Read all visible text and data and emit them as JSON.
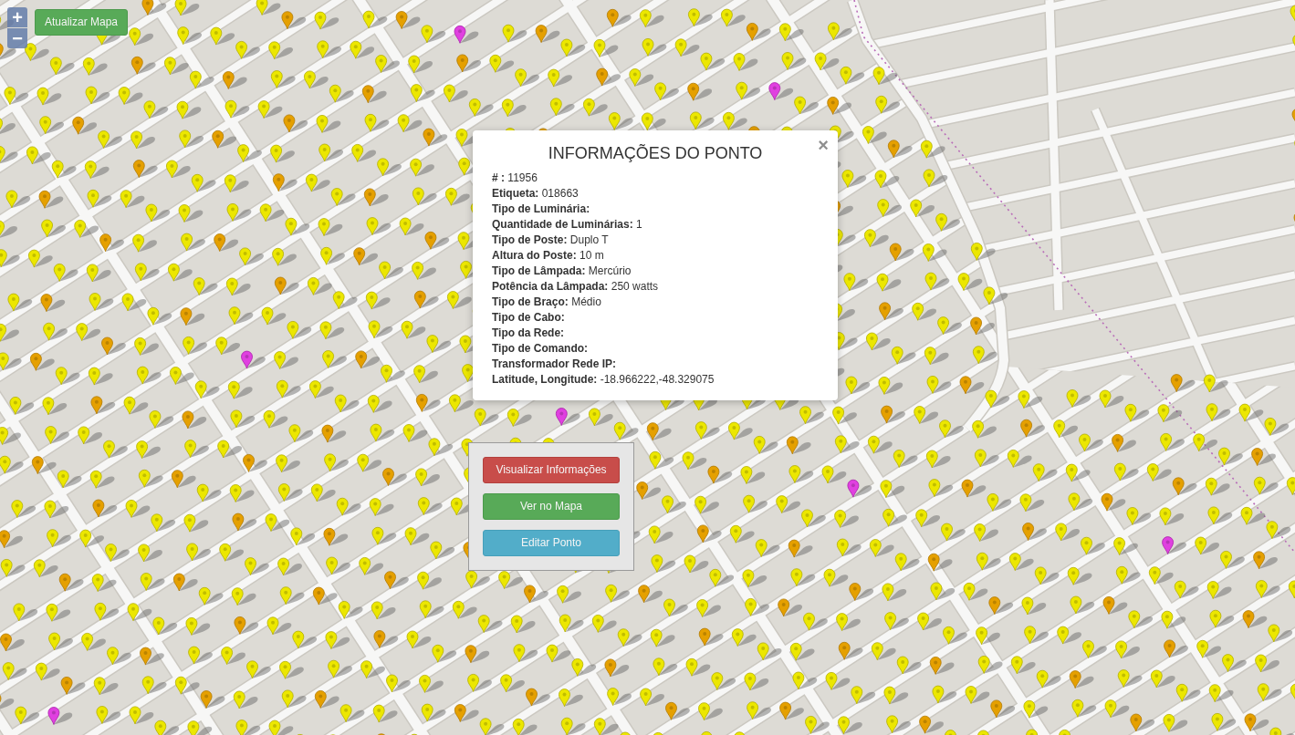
{
  "map_controls": {
    "zoom_in": "+",
    "zoom_out": "−"
  },
  "toolbar": {
    "refresh_button": "Atualizar Mapa"
  },
  "info_popup": {
    "title": "INFORMAÇÕES DO PONTO",
    "close": "×",
    "fields": [
      {
        "label": "# :",
        "value": "11956"
      },
      {
        "label": "Etiqueta:",
        "value": "018663"
      },
      {
        "label": "Tipo de Luminária:"
      },
      {
        "label": "Quantidade de Luminárias:",
        "value": "1"
      },
      {
        "label": "Tipo de Poste:",
        "value": "Duplo T"
      },
      {
        "label": "Altura do Poste:",
        "value": "10 m"
      },
      {
        "label": "Tipo de Lâmpada:",
        "value": "Mercúrio"
      },
      {
        "label": "Potência da Lâmpada:",
        "value": "250 watts"
      },
      {
        "label": "Tipo de Braço:",
        "value": "Médio"
      },
      {
        "label": "Tipo de Cabo:"
      },
      {
        "label": "Tipo da Rede:"
      },
      {
        "label": "Tipo de Comando:"
      },
      {
        "label": "Transformador Rede IP:"
      },
      {
        "label": "Latitude, Longitude:",
        "value": "-18.966222,-48.329075"
      }
    ]
  },
  "context_menu": {
    "buttons": [
      {
        "label": "Visualizar Informações",
        "kind": "danger"
      },
      {
        "label": "Ver no Mapa",
        "kind": "success"
      },
      {
        "label": "Editar Ponto",
        "kind": "info"
      }
    ]
  }
}
